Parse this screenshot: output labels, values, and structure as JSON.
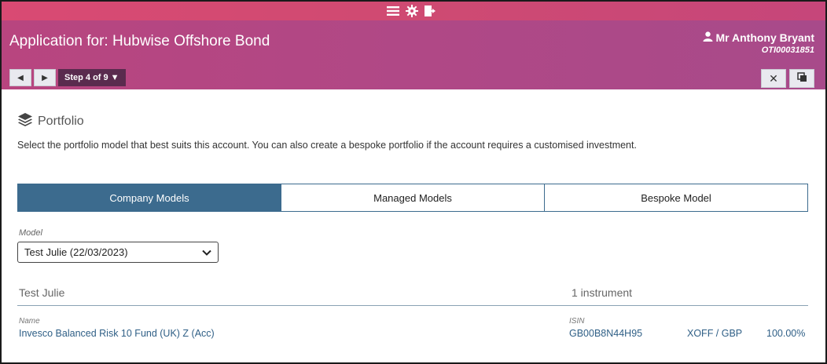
{
  "colors": {
    "topbar": "#d94a73",
    "header": "#b04886",
    "step_bg": "#5a2b4e",
    "tab_active": "#3c6b8e",
    "link_text": "#2f5f86"
  },
  "topbar": {
    "icons": [
      "menu-icon",
      "gear-icon",
      "logout-icon"
    ]
  },
  "header": {
    "title": "Application for: Hubwise Offshore Bond",
    "user_name": "Mr Anthony Bryant",
    "user_id": "OTI00031851",
    "step_label": "Step 4 of 9"
  },
  "section": {
    "title": "Portfolio",
    "intro": "Select the portfolio model that best suits this account. You can also create a bespoke portfolio if the account requires a customised investment."
  },
  "tabs": [
    {
      "label": "Company Models",
      "active": true
    },
    {
      "label": "Managed Models",
      "active": false
    },
    {
      "label": "Bespoke Model",
      "active": false
    }
  ],
  "model": {
    "label": "Model",
    "selected": "Test Julie (22/03/2023)"
  },
  "summary": {
    "name": "Test Julie",
    "count": "1 instrument"
  },
  "holdings": {
    "name_label": "Name",
    "isin_label": "ISIN",
    "rows": [
      {
        "name": "Invesco Balanced Risk 10 Fund (UK) Z (Acc)",
        "isin": "GB00B8N44H95",
        "market": "XOFF / GBP",
        "weight": "100.00%"
      }
    ]
  }
}
